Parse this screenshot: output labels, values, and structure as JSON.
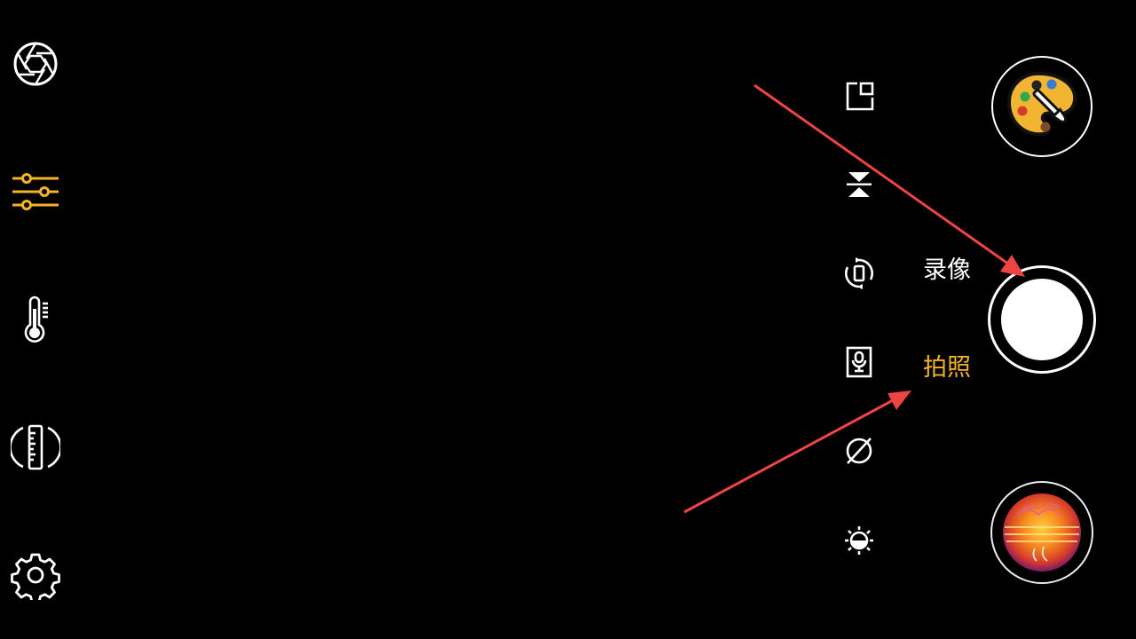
{
  "left_toolbar": {
    "items": [
      {
        "name": "aperture-icon",
        "color": "#ffffff"
      },
      {
        "name": "sliders-icon",
        "color": "#f5b428",
        "active": true
      },
      {
        "name": "thermometer-icon",
        "color": "#ffffff"
      },
      {
        "name": "ruler-icon",
        "color": "#ffffff"
      },
      {
        "name": "gear-icon",
        "color": "#ffffff"
      }
    ]
  },
  "middle_toolbar": {
    "items": [
      {
        "name": "crop-frame-icon"
      },
      {
        "name": "flip-icon"
      },
      {
        "name": "rotate-icon"
      },
      {
        "name": "audio-icon"
      },
      {
        "name": "no-filter-icon"
      },
      {
        "name": "brightness-icon"
      }
    ]
  },
  "modes": {
    "video_label": "录像",
    "photo_label": "拍照",
    "selected": "photo",
    "active_color": "#f5b428",
    "inactive_color": "#ffffff"
  },
  "right_panel": {
    "palette_button": {
      "name": "palette-icon"
    },
    "shutter_button": {
      "name": "shutter-button"
    },
    "gallery_thumbnail": {
      "name": "thermal-thumbnail"
    }
  },
  "annotations": {
    "arrow_color": "#ee4444",
    "arrows": [
      {
        "target": "shutter-button"
      },
      {
        "target": "mode-photo"
      }
    ]
  }
}
